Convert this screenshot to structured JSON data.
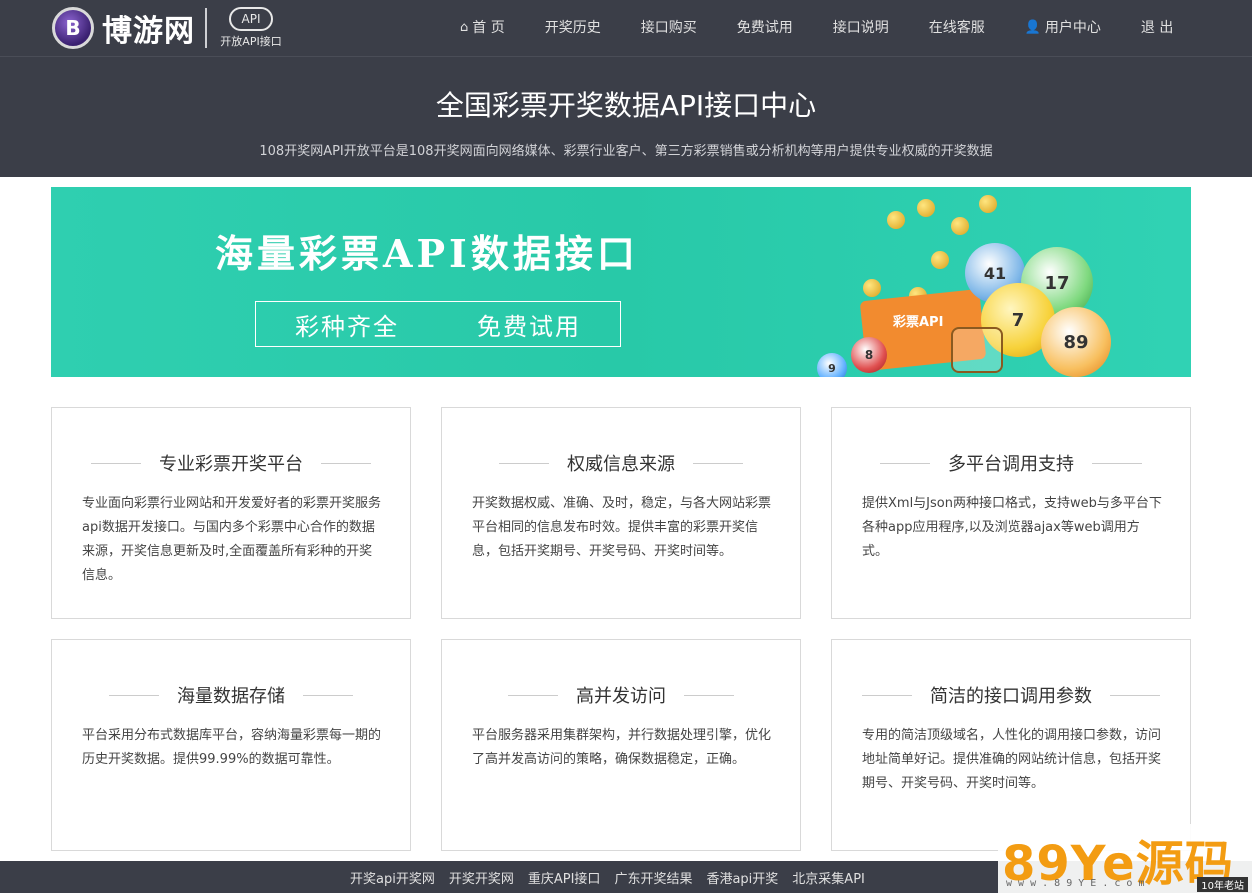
{
  "header": {
    "logo_letter": "B",
    "logo_text": "博游网",
    "logo_api": "API",
    "logo_api_sub": "开放API接口",
    "nav": [
      {
        "label": "首 页",
        "icon": "home-icon"
      },
      {
        "label": "开奖历史"
      },
      {
        "label": "接口购买"
      },
      {
        "label": "免费试用"
      },
      {
        "label": "接口说明"
      },
      {
        "label": "在线客服"
      },
      {
        "label": "用户中心",
        "icon": "user-icon"
      },
      {
        "label": "退 出"
      }
    ]
  },
  "hero": {
    "title": "全国彩票开奖数据API接口中心",
    "subtitle": "108开奖网API开放平台是108开奖网面向网络媒体、彩票行业客户、第三方彩票销售或分析机构等用户提供专业权威的开奖数据"
  },
  "banner": {
    "title": "海量彩票API数据接口",
    "tag1": "彩种齐全",
    "tag2": "免费试用",
    "ticket_label": "彩票API",
    "balls": [
      "41",
      "17",
      "7",
      "89",
      "8",
      "9"
    ]
  },
  "cards": [
    {
      "title": "专业彩票开奖平台",
      "body": "专业面向彩票行业网站和开发爱好者的彩票开奖服务api数据开发接口。与国内多个彩票中心合作的数据来源，开奖信息更新及时,全面覆盖所有彩种的开奖信息。"
    },
    {
      "title": "权威信息来源",
      "body": "开奖数据权威、准确、及时，稳定，与各大网站彩票平台相同的信息发布时效。提供丰富的彩票开奖信息，包括开奖期号、开奖号码、开奖时间等。"
    },
    {
      "title": "多平台调用支持",
      "body": "提供Xml与Json两种接口格式，支持web与多平台下各种app应用程序,以及浏览器ajax等web调用方式。"
    },
    {
      "title": "海量数据存储",
      "body": "平台采用分布式数据库平台，容纳海量彩票每一期的历史开奖数据。提供99.99%的数据可靠性。"
    },
    {
      "title": "高并发访问",
      "body": "平台服务器采用集群架构，并行数据处理引擎，优化了高并发高访问的策略，确保数据稳定，正确。"
    },
    {
      "title": "简洁的接口调用参数",
      "body": "专用的简洁顶级域名，人性化的调用接口参数，访问地址简单好记。提供准确的网站统计信息，包括开奖期号、开奖号码、开奖时间等。"
    }
  ],
  "footer": {
    "links": [
      "开奖api开奖网",
      "开奖开奖网",
      "重庆API接口",
      "广东开奖结果",
      "香港api开奖",
      "北京采集API"
    ]
  },
  "watermark": {
    "main": "89Ye源码",
    "url": "w w w . 8 9 Y E . c o m",
    "tag": "10年老站"
  },
  "colors": {
    "header_bg": "#3b3e48",
    "banner_bg": "#2fcfb0",
    "card_border": "#d9d9d9"
  }
}
